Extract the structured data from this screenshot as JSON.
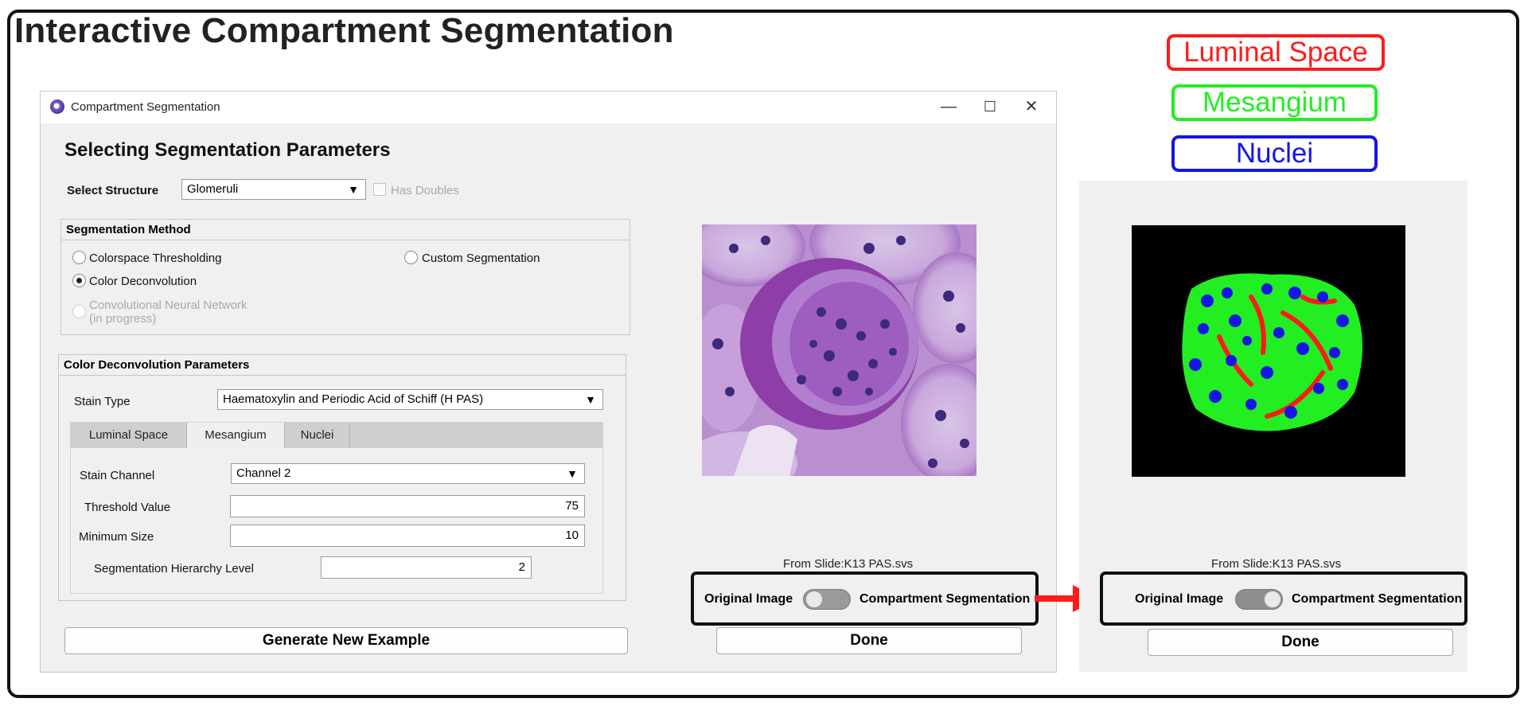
{
  "figure": {
    "title": "Interactive Compartment Segmentation",
    "legend": [
      {
        "label": "Luminal Space",
        "color": "#ff1a1a"
      },
      {
        "label": "Mesangium",
        "color": "#22ee22"
      },
      {
        "label": "Nuclei",
        "color": "#1515e6"
      }
    ],
    "arrow_color": "#ff1a1a"
  },
  "window": {
    "title": "Compartment Segmentation",
    "controls": {
      "minimize": "—",
      "maximize": "☐",
      "close": "✕"
    }
  },
  "params": {
    "heading": "Selecting Segmentation Parameters",
    "structure_label": "Select Structure",
    "structure_value": "Glomeruli",
    "has_doubles_label": "Has Doubles"
  },
  "seg_method": {
    "title": "Segmentation Method",
    "options": [
      {
        "label": "Colorspace Thresholding",
        "selected": false,
        "enabled": true
      },
      {
        "label": "Custom Segmentation",
        "selected": false,
        "enabled": true
      },
      {
        "label": "Color Deconvolution",
        "selected": true,
        "enabled": true
      },
      {
        "label": "Convolutional Neural Network",
        "sublabel": "(in progress)",
        "selected": false,
        "enabled": false
      }
    ]
  },
  "deconv": {
    "title": "Color Deconvolution Parameters",
    "stain_type_label": "Stain Type",
    "stain_type_value": "Haematoxylin and Periodic Acid of Schiff (H PAS)",
    "tabs": [
      {
        "label": "Luminal Space",
        "active": false
      },
      {
        "label": "Mesangium",
        "active": true
      },
      {
        "label": "Nuclei",
        "active": false
      }
    ],
    "stain_channel_label": "Stain Channel",
    "stain_channel_value": "Channel 2",
    "threshold_label": "Threshold Value",
    "threshold_value": "75",
    "min_size_label": "Minimum Size",
    "min_size_value": "10",
    "hierarchy_label": "Segmentation Hierarchy Level",
    "hierarchy_value": "2"
  },
  "actions": {
    "generate_label": "Generate New Example",
    "done_label": "Done"
  },
  "preview": {
    "caption": "From Slide:K13 PAS.svs",
    "toggle_left": "Original Image",
    "toggle_right": "Compartment Segmentation",
    "toggle_state_left_panel": "original",
    "toggle_state_right_panel": "segmentation"
  }
}
